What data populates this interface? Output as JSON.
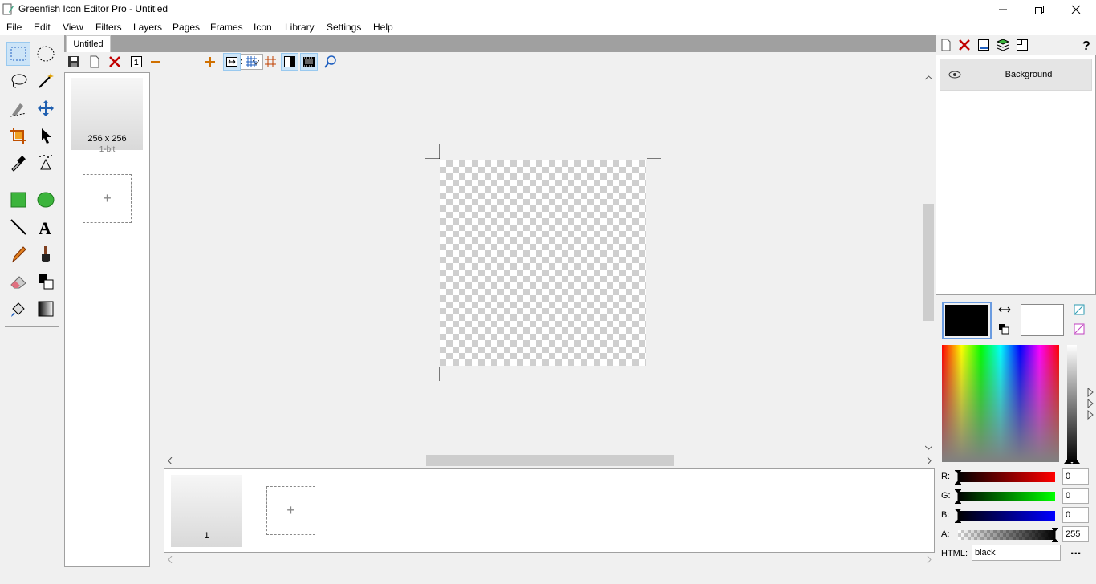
{
  "window": {
    "title": "Greenfish Icon Editor Pro - Untitled"
  },
  "menu": [
    "File",
    "Edit",
    "View",
    "Filters",
    "Layers",
    "Pages",
    "Frames",
    "Icon",
    "Library",
    "Settings",
    "Help"
  ],
  "document_tab": "Untitled",
  "toolbar": {
    "zoom": "1x"
  },
  "pages": {
    "first": {
      "size": "256 x 256",
      "depth": "1-bit"
    },
    "add": "+"
  },
  "frames": {
    "first": "1",
    "add": "+"
  },
  "layers": {
    "items": [
      {
        "name": "Background"
      }
    ]
  },
  "color": {
    "primary": "#000000",
    "secondary": "#ffffff",
    "r_label": "R:",
    "g_label": "G:",
    "b_label": "B:",
    "a_label": "A:",
    "r": "0",
    "g": "0",
    "b": "0",
    "a": "255",
    "html_label": "HTML:",
    "html": "black",
    "more": "..."
  }
}
